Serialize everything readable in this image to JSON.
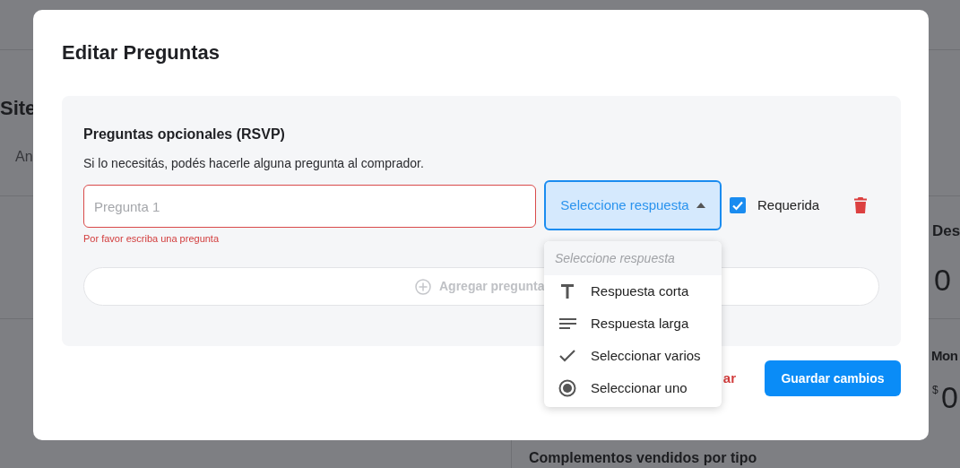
{
  "background": {
    "title": "Site",
    "tab": "An",
    "stat_1_label": "Des",
    "stat_1_value": "0",
    "stat_2_label": "Mon",
    "stat_2_currency": "$",
    "stat_2_value": "0",
    "section_title": "Complementos vendidos por tipo"
  },
  "modal": {
    "title": "Editar Preguntas",
    "section": {
      "heading": "Preguntas opcionales (RSVP)",
      "description": "Si lo necesitás, podés hacerle alguna pregunta al comprador.",
      "questions": [
        {
          "placeholder": "Pregunta 1",
          "error": "Por favor escriba una pregunta",
          "type_select": {
            "value": "Seleccione respuesta",
            "expanded": true,
            "menu_header": "Seleccione respuesta",
            "options": [
              {
                "kind": "short",
                "label": "Respuesta corta"
              },
              {
                "kind": "long",
                "label": "Respuesta larga"
              },
              {
                "kind": "multiple",
                "label": "Seleccionar varios"
              },
              {
                "kind": "single",
                "label": "Seleccionar uno"
              }
            ]
          },
          "required": {
            "label": "Requerida",
            "checked": true
          }
        }
      ],
      "add_button": "Agregar pregunta"
    },
    "cancel_button": "ar",
    "save_button": "Guardar cambios"
  }
}
